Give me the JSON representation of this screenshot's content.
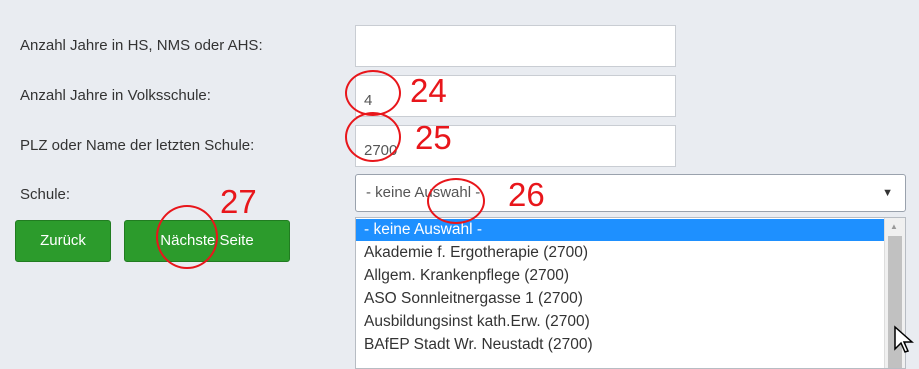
{
  "form": {
    "years_hs_label": "Anzahl Jahre in HS, NMS oder AHS:",
    "years_hs_value": "",
    "years_vs_label": "Anzahl Jahre in Volksschule:",
    "years_vs_value": "4",
    "plz_label": "PLZ oder Name der letzten Schule:",
    "plz_value": "2700",
    "school_label": "Schule:",
    "school_selected": "- keine Auswahl -"
  },
  "buttons": {
    "back_label": "Zurück",
    "next_label": "Nächste Seite",
    "color": "#2c9b2c"
  },
  "dropdown": {
    "options": [
      "- keine Auswahl -",
      "Akademie f. Ergotherapie (2700)",
      "Allgem. Krankenpflege (2700)",
      "ASO Sonnleitnergasse 1 (2700)",
      "Ausbildungsinst kath.Erw. (2700)",
      "BAfEP Stadt Wr. Neustadt (2700)"
    ],
    "highlight_color": "#1e90ff"
  },
  "annotations": {
    "color": "#e8161b",
    "labels": [
      "24",
      "25",
      "26",
      "27"
    ]
  }
}
